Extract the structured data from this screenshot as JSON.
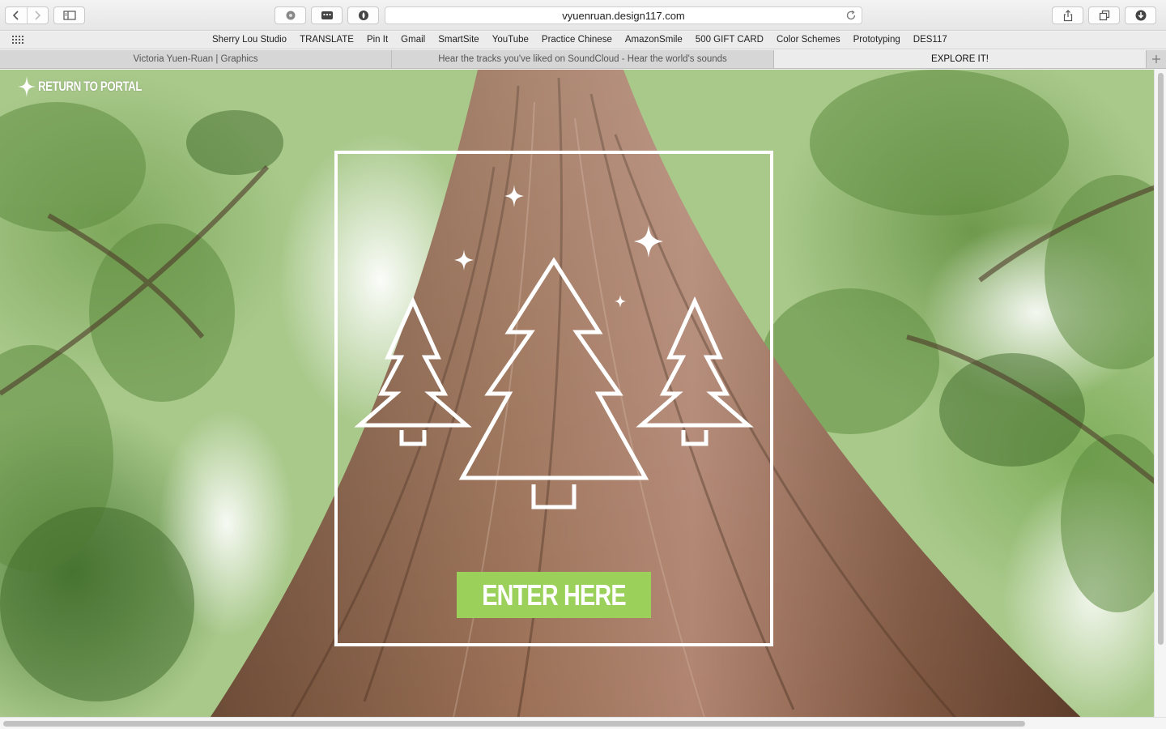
{
  "browser": {
    "url": "vyuenruan.design117.com",
    "bookmarks": [
      "Sherry Lou Studio",
      "TRANSLATE",
      "Pin It",
      "Gmail",
      "SmartSite",
      "YouTube",
      "Practice Chinese",
      "AmazonSmile",
      "500 GIFT CARD",
      "Color Schemes",
      "Prototyping",
      "DES117"
    ],
    "tabs": [
      {
        "title": "Victoria Yuen-Ruan | Graphics",
        "active": false
      },
      {
        "title": "Hear the tracks you've liked on SoundCloud - Hear the world's sounds",
        "active": false
      },
      {
        "title": "EXPLORE IT!",
        "active": true
      }
    ]
  },
  "page": {
    "return_label": "RETURN TO PORTAL",
    "enter_label": "ENTER HERE",
    "colors": {
      "enter_button": "#9bd15a",
      "frame": "#ffffff"
    }
  }
}
